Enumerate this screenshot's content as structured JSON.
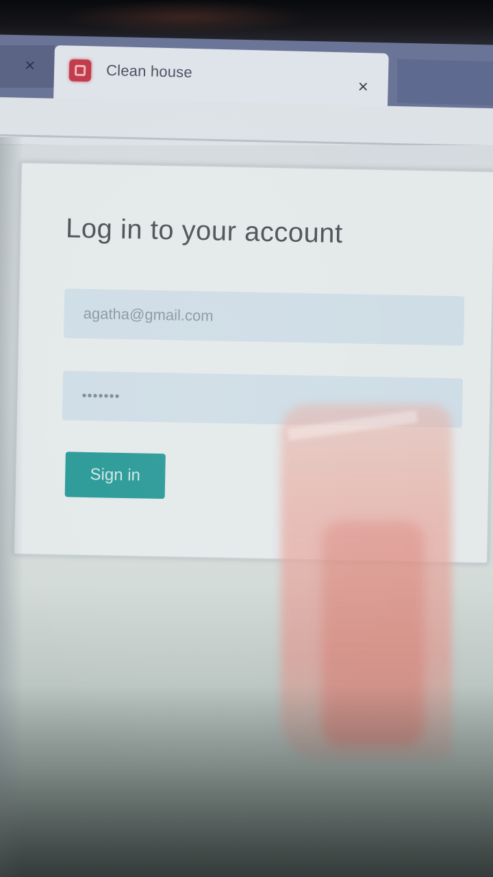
{
  "browser": {
    "prev_tab_close": "×",
    "active_tab": {
      "favicon": "app-logo-icon",
      "title": "Clean house",
      "close": "×"
    }
  },
  "login": {
    "heading": "Log in to your account",
    "email": {
      "value": "agatha@gmail.com"
    },
    "password": {
      "value": "•••••••"
    },
    "submit_label": "Sign in"
  },
  "colors": {
    "accent": "#2a9a98",
    "field_bg": "#cfdde6",
    "favicon": "#c23b4a"
  }
}
